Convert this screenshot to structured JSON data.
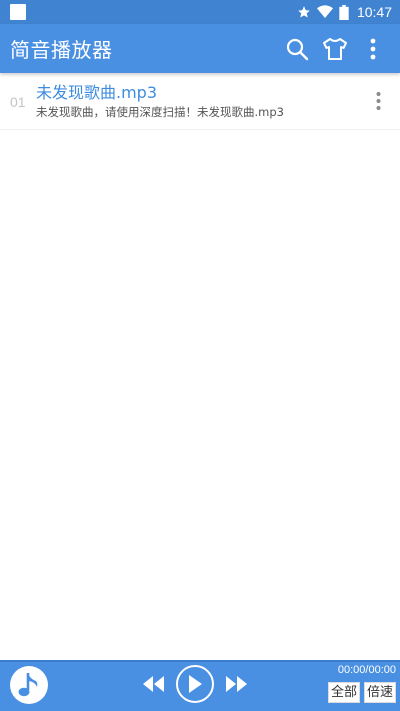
{
  "status_bar": {
    "time": "10:47"
  },
  "app_bar": {
    "title": "简音播放器"
  },
  "songs": [
    {
      "index": "01",
      "title": "未发现歌曲.mp3",
      "subtitle": "未发现歌曲，请使用深度扫描！未发现歌曲.mp3"
    }
  ],
  "player": {
    "time": "00:00/00:00",
    "all_label": "全部",
    "speed_label": "倍速"
  },
  "colors": {
    "status_bar": "#3f83d1",
    "app_bar": "#4a90e2",
    "accent_text": "#3d8ce0"
  },
  "icons": {
    "status": [
      "notification-icon",
      "star-icon",
      "wifi-icon"
    ],
    "app_bar": [
      "search-icon",
      "shirt-icon",
      "more-vert-icon"
    ],
    "player": [
      "music-note-icon",
      "rewind-icon",
      "play-icon",
      "fast-forward-icon"
    ]
  }
}
